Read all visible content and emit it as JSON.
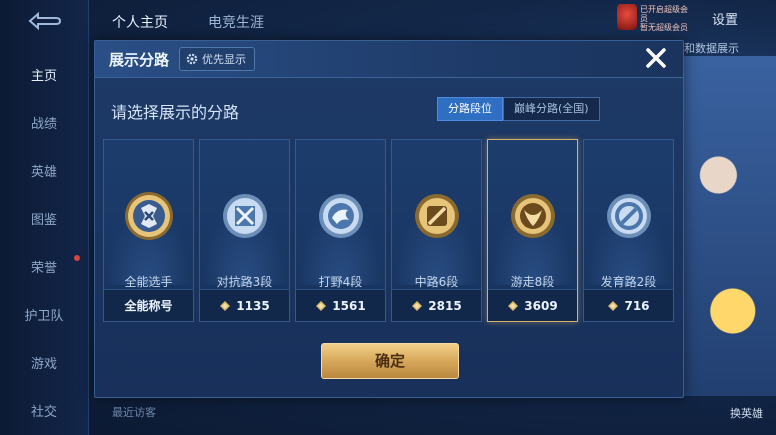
{
  "nav": {
    "items": [
      {
        "label": "主页",
        "active": true
      },
      {
        "label": "战绩",
        "active": false
      },
      {
        "label": "英雄",
        "active": false
      },
      {
        "label": "图鉴",
        "active": false
      },
      {
        "label": "荣誉",
        "active": false
      },
      {
        "label": "护卫队",
        "active": false
      },
      {
        "label": "游戏",
        "active": false
      },
      {
        "label": "社交",
        "active": false
      }
    ]
  },
  "topbar": {
    "tabs": [
      {
        "label": "个人主页",
        "active": true
      },
      {
        "label": "电竞生涯",
        "active": false
      }
    ],
    "settings_label": "设置",
    "badge_lines": [
      "已开启超级会员",
      "暂无超级会员"
    ]
  },
  "background": {
    "right_chip": "和数据展示",
    "corner_label": "换英雄",
    "recent_label": "最近访客"
  },
  "modal": {
    "title": "展示分路",
    "priority_label": "优先显示",
    "prompt": "请选择展示的分路",
    "segments": [
      {
        "label": "分路段位",
        "active": true
      },
      {
        "label": "巅峰分路(全国)",
        "active": false
      }
    ],
    "cards": [
      {
        "label": "全能选手",
        "value": "全能称号",
        "points_icon": false,
        "selected": false,
        "emblem": "gold",
        "icon": "allround-emblem-icon"
      },
      {
        "label": "对抗路3段",
        "value": "1135",
        "points_icon": true,
        "selected": false,
        "emblem": "silver",
        "icon": "clash-lane-emblem-icon"
      },
      {
        "label": "打野4段",
        "value": "1561",
        "points_icon": true,
        "selected": false,
        "emblem": "silver",
        "icon": "jungle-emblem-icon"
      },
      {
        "label": "中路6段",
        "value": "2815",
        "points_icon": true,
        "selected": false,
        "emblem": "gold",
        "icon": "mid-lane-emblem-icon"
      },
      {
        "label": "游走8段",
        "value": "3609",
        "points_icon": true,
        "selected": true,
        "emblem": "gold",
        "icon": "roam-emblem-icon"
      },
      {
        "label": "发育路2段",
        "value": "716",
        "points_icon": true,
        "selected": false,
        "emblem": "silver",
        "icon": "farm-lane-emblem-icon"
      }
    ],
    "confirm_label": "确定"
  },
  "colors": {
    "accent_gold": "#d8b06a",
    "segment_active": "#2f6fc2",
    "modal_bg": "#1e3a66"
  }
}
